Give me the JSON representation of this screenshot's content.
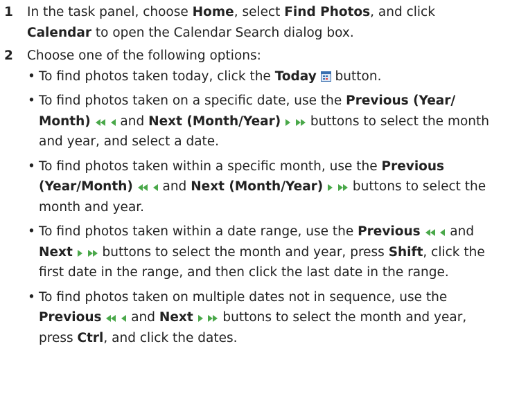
{
  "step1": {
    "number": "1",
    "t1": "In the task panel, choose ",
    "b1": "Home",
    "t2": ", select ",
    "b2": "Find Photos",
    "t3": ", and click ",
    "b3": "Calendar",
    "t4": " to open the Calendar Search dialog box."
  },
  "step2": {
    "number": "2",
    "text": "Choose one of the following options:"
  },
  "options": {
    "o1": {
      "t1": "To find photos taken today, click the ",
      "b1": "Today",
      "t2": " button."
    },
    "o2": {
      "t1": "To find photos taken on a specific date, use the ",
      "b1": "Previous (Year/ Month)",
      "t2": " and ",
      "b2": "Next (Month/Year)",
      "t3": " buttons to select the month and year, and select a date."
    },
    "o3": {
      "t1": "To find photos taken within a specific month, use the ",
      "b1": "Previous (Year/Month)",
      "t2": " and ",
      "b2": "Next (Month/Year)",
      "t3": " buttons to select the month and year."
    },
    "o4": {
      "t1": "To find photos taken within a date range, use the ",
      "b1": "Previous",
      "t2": " and ",
      "b2": "Next",
      "t3": " buttons to select the month and year, press ",
      "b3": "Shift",
      "t4": ", click the first date in the range, and then click the last date in the range."
    },
    "o5": {
      "t1": "To find photos taken on multiple dates not in sequence, use the ",
      "b1": "Previous",
      "t2": " and ",
      "b2": "Next",
      "t3": " buttons to select the month and year, press ",
      "b3": "Ctrl",
      "t4": ", and click the dates."
    }
  },
  "icons": {
    "nav_color": "#4aa84a",
    "calendar_color": "#3a6fb0"
  }
}
